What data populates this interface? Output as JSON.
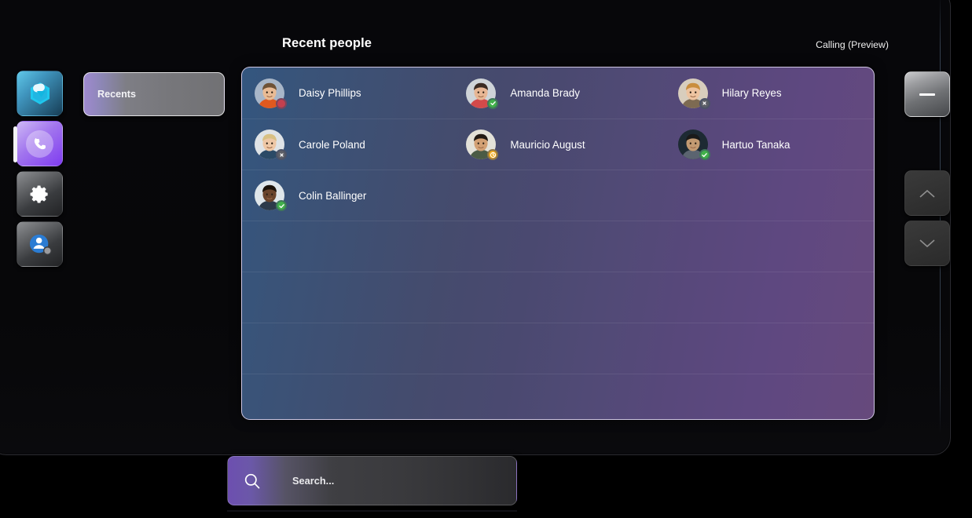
{
  "window": {
    "app_title": "Calling (Preview)"
  },
  "header": {
    "title": "Recent people",
    "right_label": "Calling (Preview)"
  },
  "rail": {
    "items": [
      {
        "name": "teams-app",
        "icon": "teams-logo-icon",
        "active": false
      },
      {
        "name": "calls",
        "icon": "phone-icon",
        "active": true
      },
      {
        "name": "settings",
        "icon": "gear-icon",
        "active": false
      },
      {
        "name": "account",
        "icon": "person-avatar-icon",
        "active": false
      }
    ]
  },
  "filters": {
    "recents_label": "Recents"
  },
  "contacts": {
    "rows": [
      [
        {
          "name": "Daisy Phillips",
          "presence": "busy"
        },
        {
          "name": "Amanda Brady",
          "presence": "available"
        },
        {
          "name": "Hilary Reyes",
          "presence": "offline"
        }
      ],
      [
        {
          "name": "Carole Poland",
          "presence": "offline"
        },
        {
          "name": "Mauricio August",
          "presence": "away"
        },
        {
          "name": "Hartuo Tanaka",
          "presence": "available"
        }
      ],
      [
        {
          "name": "Colin Ballinger",
          "presence": "available"
        }
      ]
    ]
  },
  "controls": {
    "minimize_label": "Minimize",
    "scroll_up_label": "Scroll up",
    "scroll_down_label": "Scroll down"
  },
  "search": {
    "placeholder": "Search...",
    "value": ""
  },
  "colors": {
    "accent_purple": "#7f3cf0",
    "accent_cyan": "#5fc7e8",
    "panel_blue": "#33567f",
    "panel_purple": "#66497c",
    "presence_available": "#41b14a",
    "presence_busy": "#c4404f",
    "presence_away": "#f2ad20",
    "presence_offline": "#5d5f67"
  }
}
